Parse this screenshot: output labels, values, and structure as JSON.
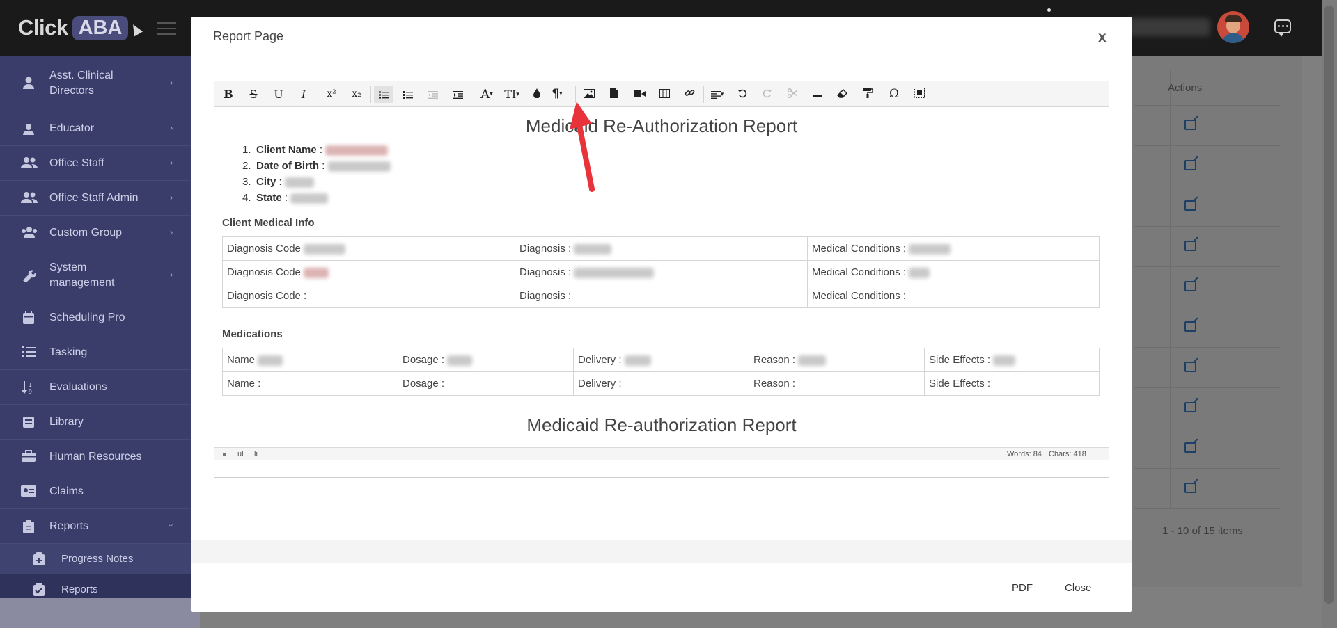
{
  "app": {
    "logo_text": "Click",
    "logo_badge": "ABA"
  },
  "sidebar": {
    "items": [
      {
        "label": "Asst. Clinical Directors",
        "icon": "user-tie-icon"
      },
      {
        "label": "Educator",
        "icon": "graduation-cap-icon"
      },
      {
        "label": "Office Staff",
        "icon": "users-icon"
      },
      {
        "label": "Office Staff Admin",
        "icon": "users-cog-icon"
      },
      {
        "label": "Custom Group",
        "icon": "user-group-icon"
      },
      {
        "label": "System management",
        "icon": "wrench-icon"
      },
      {
        "label": "Scheduling Pro",
        "icon": "calendar-icon"
      },
      {
        "label": "Tasking",
        "icon": "tasks-icon"
      },
      {
        "label": "Evaluations",
        "icon": "sort-numeric-icon"
      },
      {
        "label": "Library",
        "icon": "book-icon"
      },
      {
        "label": "Human Resources",
        "icon": "briefcase-icon"
      },
      {
        "label": "Claims",
        "icon": "id-card-icon"
      },
      {
        "label": "Reports",
        "icon": "clipboard-icon"
      }
    ],
    "subitems": [
      {
        "label": "Progress Notes",
        "icon": "clipboard-plus-icon"
      },
      {
        "label": "Reports",
        "icon": "clipboard-check-icon"
      }
    ]
  },
  "background_table": {
    "actions_header": "Actions",
    "row_count": 10,
    "pager_text": "1 - 10 of 15 items"
  },
  "modal": {
    "title": "Report Page",
    "close_glyph": "x",
    "footer": {
      "pdf": "PDF",
      "close": "Close"
    }
  },
  "editor": {
    "toolbar": {
      "bold": "B",
      "strike": "S",
      "underline": "U",
      "italic": "I",
      "superscript": "x²",
      "subscript": "x₂",
      "font_color": "A",
      "font_size": "TI",
      "paragraph": "¶",
      "omega": "Ω"
    },
    "content": {
      "title": "Medicaid Re-Authorization Report",
      "client_fields": [
        {
          "num": "1.",
          "label": "Client Name",
          "sep": " :"
        },
        {
          "num": "2.",
          "label": "Date of Birth",
          "sep": " :"
        },
        {
          "num": "3.",
          "label": "City",
          "sep": " :"
        },
        {
          "num": "4.",
          "label": "State",
          "sep": " :"
        }
      ],
      "medical_heading": "Client Medical Info",
      "medical_rows": [
        [
          "Diagnosis Code",
          "Diagnosis :",
          "Medical Conditions :"
        ],
        [
          "Diagnosis Code",
          "Diagnosis :",
          "Medical Conditions :"
        ],
        [
          "Diagnosis Code :",
          "Diagnosis :",
          "Medical Conditions :"
        ]
      ],
      "medications_heading": "Medications",
      "medication_rows": [
        [
          "Name",
          "Dosage :",
          "Delivery :",
          "Reason :",
          "Side Effects :"
        ],
        [
          "Name :",
          "Dosage :",
          "Delivery :",
          "Reason :",
          "Side Effects :"
        ]
      ],
      "footer_title": "Medicaid Re-authorization Report"
    },
    "status": {
      "path1": "ul",
      "path2": "li",
      "words": "Words: 84",
      "chars": "Chars: 418"
    }
  },
  "colors": {
    "sidebar": "#3a3d69",
    "annotation_arrow": "#e8333a"
  }
}
